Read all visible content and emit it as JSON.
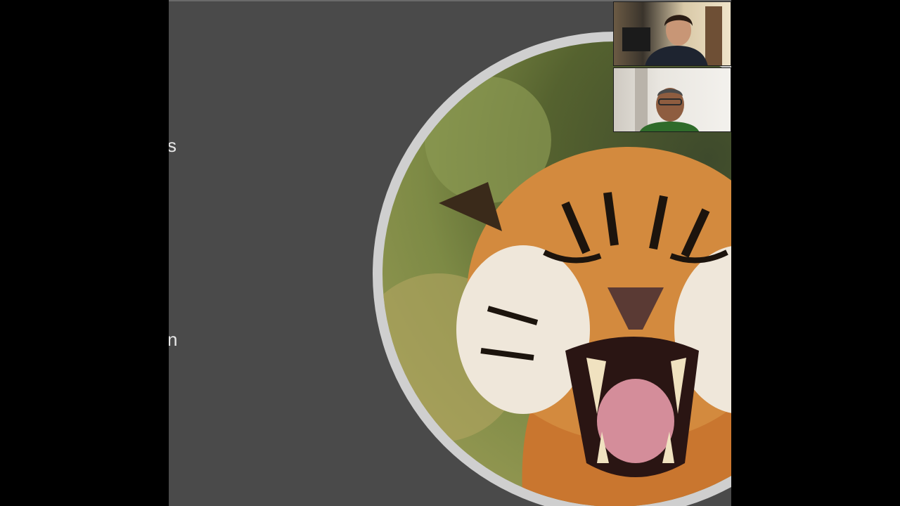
{
  "slide": {
    "text_fragments": [
      "s",
      "n"
    ]
  },
  "photo": {
    "subject": "tiger-photo"
  },
  "participants": [
    {
      "id": "participant-1"
    },
    {
      "id": "participant-2"
    }
  ],
  "colors": {
    "background": "#000000",
    "slide": "#4a4a4a",
    "ring": "#cfcfcf"
  }
}
